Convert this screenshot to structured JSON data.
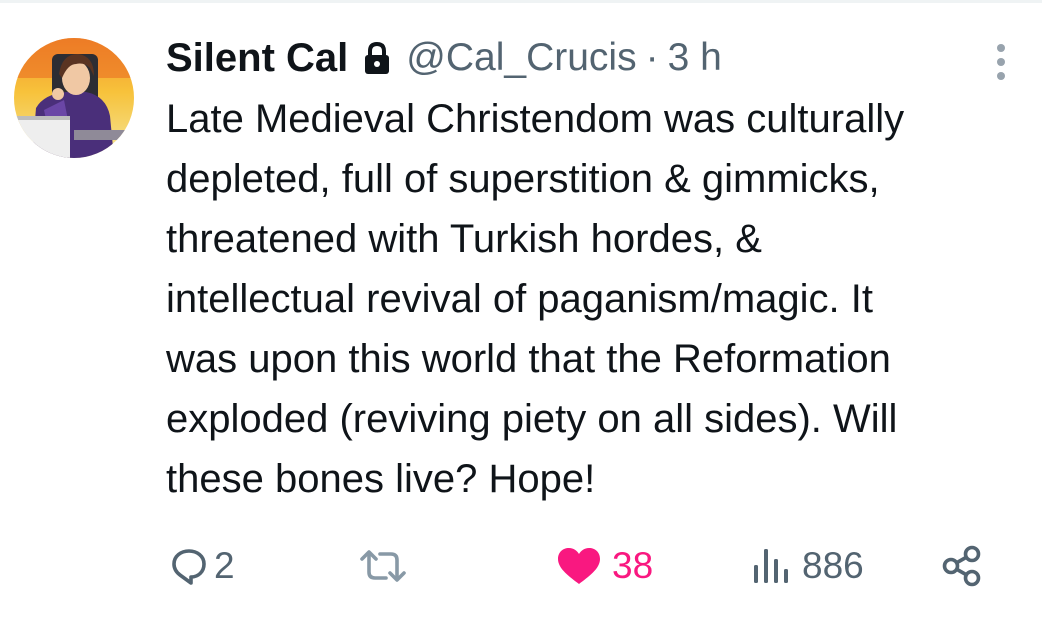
{
  "author": {
    "display_name": "Silent Cal",
    "handle": "@Cal_Crucis",
    "separator": "·",
    "time": "3 h",
    "protected": true
  },
  "tweet": {
    "text": "Late Medieval Christendom was culturally\ndepleted, full of superstition & gimmicks,\nthreatened with Turkish hordes, &\nintellectual revival of paganism/magic. It\nwas upon this world that the Reformation\nexploded (reviving piety on all sides). Will\nthese bones live? Hope!"
  },
  "actions": {
    "replies": "2",
    "retweets": "",
    "likes": "38",
    "views": "886",
    "liked": true
  },
  "colors": {
    "text_primary": "#0f1419",
    "text_secondary": "#536471",
    "like_active": "#f91880",
    "divider": "#eff3f4"
  },
  "icons": {
    "lock": "lock-icon",
    "more": "more-vertical-icon",
    "reply": "reply-icon",
    "retweet": "retweet-icon",
    "like": "heart-filled-icon",
    "views": "views-icon",
    "share": "share-icon"
  }
}
